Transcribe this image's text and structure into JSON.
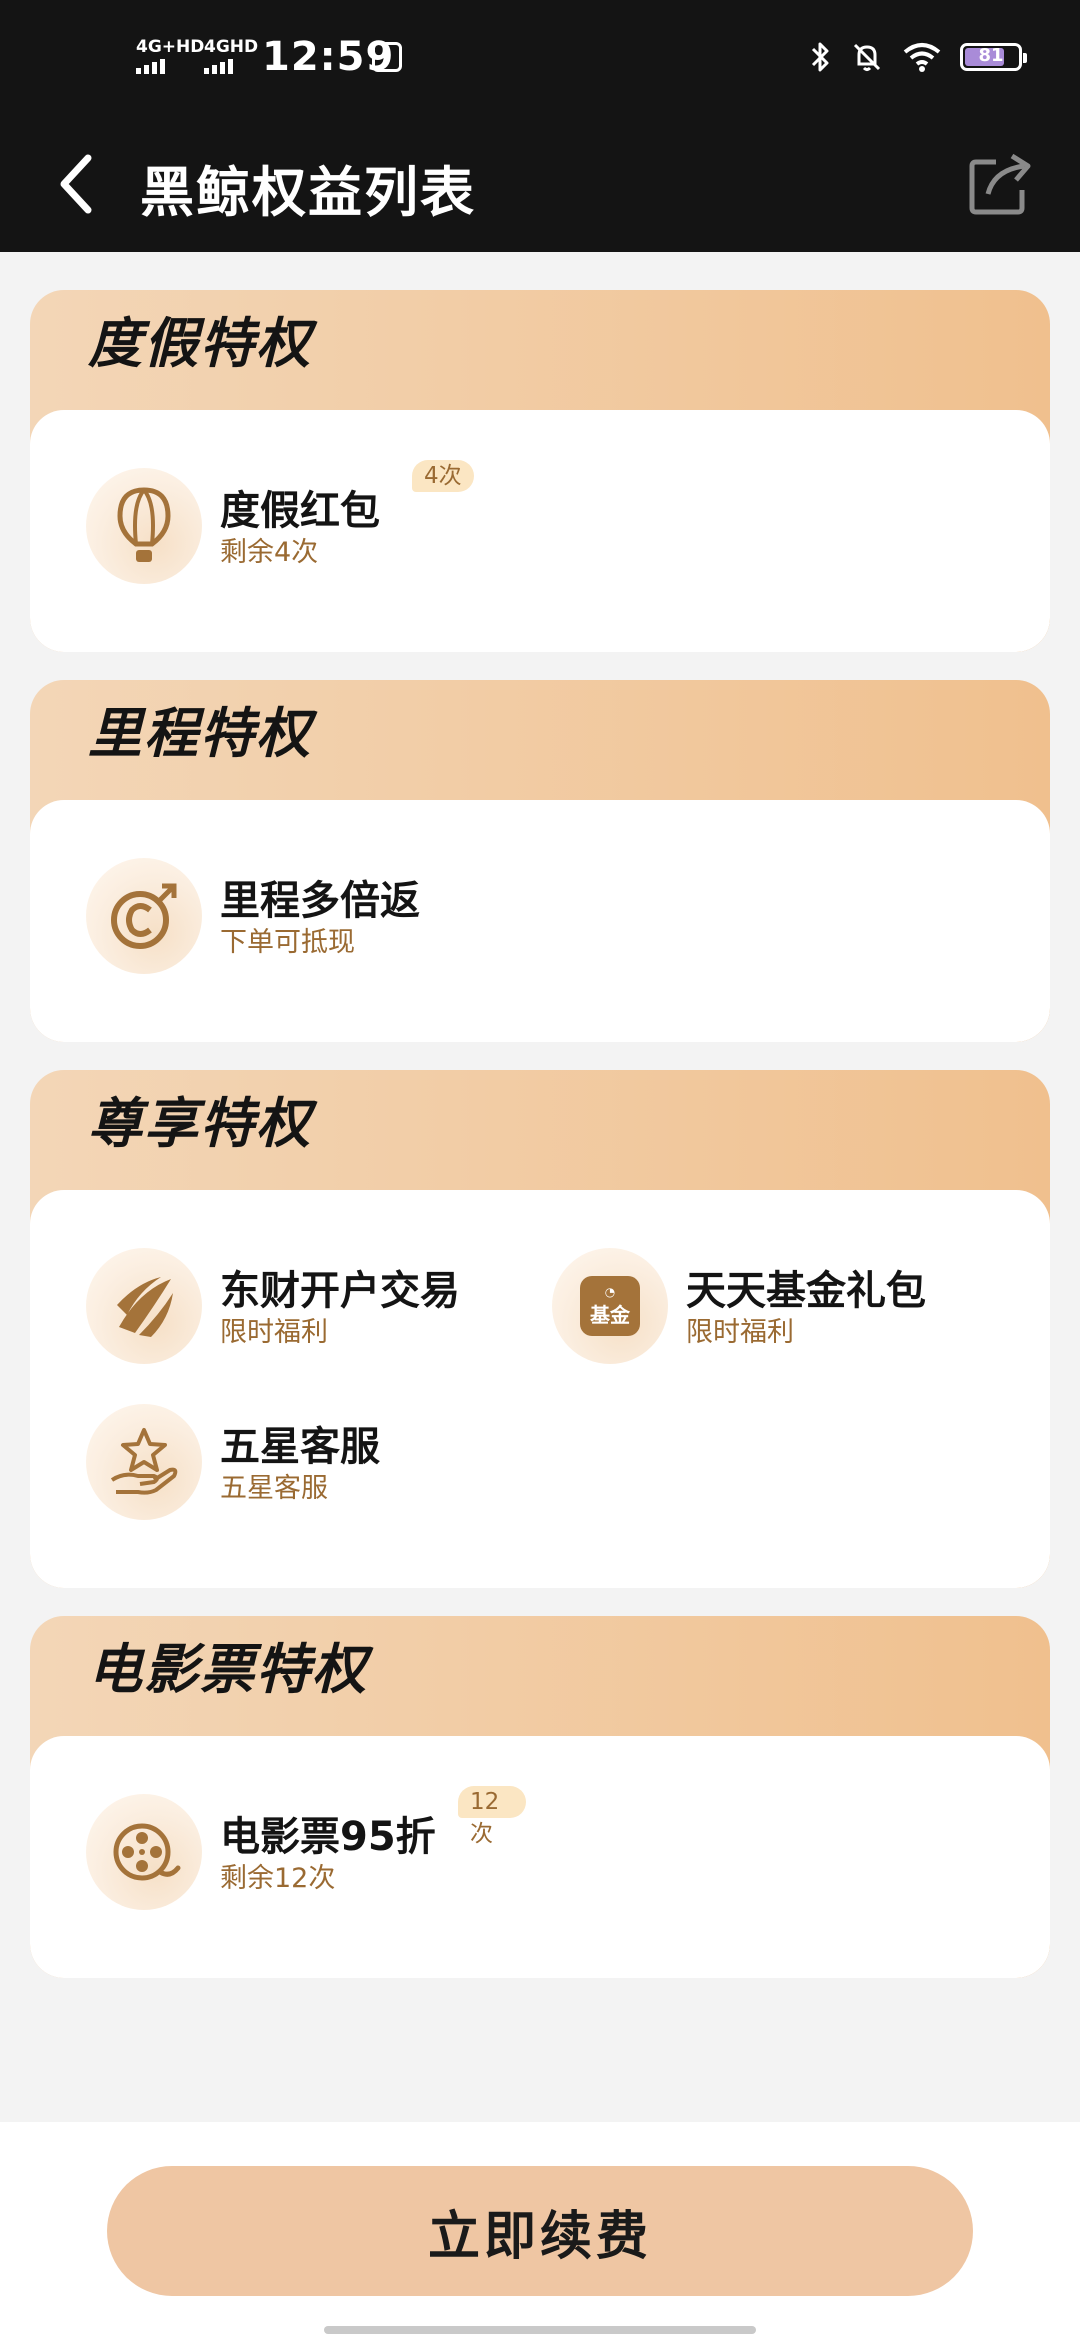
{
  "status_bar": {
    "net1": "4G+HD",
    "net2": "4GHD",
    "time": "12:59",
    "battery": "81"
  },
  "header": {
    "title": "黑鲸权益列表"
  },
  "sections": [
    {
      "title": "度假特权",
      "items": [
        {
          "title": "度假红包",
          "subtitle": "剩余4次",
          "badge": "4次",
          "icon": "hot-air-balloon-icon"
        }
      ]
    },
    {
      "title": "里程特权",
      "items": [
        {
          "title": "里程多倍返",
          "subtitle": "下单可抵现",
          "icon": "mileage-coin-icon"
        }
      ]
    },
    {
      "title": "尊享特权",
      "items": [
        {
          "title": "东财开户交易",
          "subtitle": "限时福利",
          "icon": "eastmoney-logo-icon"
        },
        {
          "title": "天天基金礼包",
          "subtitle": "限时福利",
          "icon": "fund-logo-icon",
          "icon_text": "基金"
        },
        {
          "title": "五星客服",
          "subtitle": "五星客服",
          "icon": "star-hand-icon"
        }
      ]
    },
    {
      "title": "电影票特权",
      "items": [
        {
          "title": "电影票95折",
          "subtitle": "剩余12次",
          "badge": "12次",
          "icon": "film-reel-icon"
        }
      ]
    }
  ],
  "footer": {
    "renew_label": "立即续费"
  },
  "colors": {
    "icon_gold": "#a4733a",
    "header_bg": "#141414",
    "button_bg": "#efc6a3"
  }
}
